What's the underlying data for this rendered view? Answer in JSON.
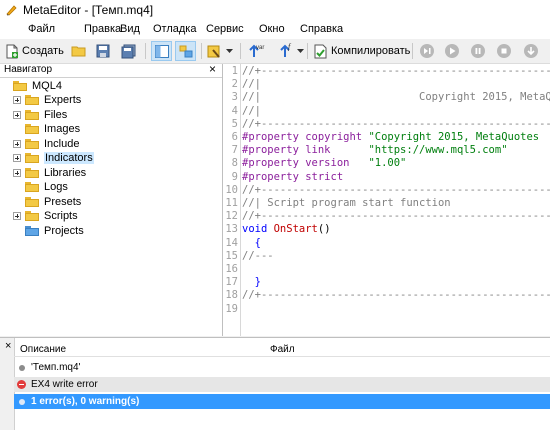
{
  "window": {
    "title": "MetaEditor - [Темп.mq4]"
  },
  "menu": [
    "Файл",
    "Правка",
    "Вид",
    "Отладка",
    "Сервис",
    "Окно",
    "Справка"
  ],
  "toolbar": {
    "create_label": "Создать",
    "compile_label": "Компилировать",
    "var_icon_text": "var",
    "f_icon_text": "f"
  },
  "navigator": {
    "title": "Навигатор",
    "close": "×",
    "root": "MQL4",
    "items": [
      {
        "label": "Experts",
        "expandable": true
      },
      {
        "label": "Files",
        "expandable": true
      },
      {
        "label": "Images",
        "expandable": false
      },
      {
        "label": "Include",
        "expandable": true
      },
      {
        "label": "Indicators",
        "expandable": true,
        "selected": true
      },
      {
        "label": "Libraries",
        "expandable": true
      },
      {
        "label": "Logs",
        "expandable": false
      },
      {
        "label": "Presets",
        "expandable": false
      },
      {
        "label": "Scripts",
        "expandable": true
      },
      {
        "label": "Projects",
        "expandable": false,
        "color": "blue"
      }
    ]
  },
  "editor": {
    "lines": [
      {
        "n": "1",
        "parts": [
          [
            "comment",
            "//+------------------------------------------------"
          ]
        ]
      },
      {
        "n": "2",
        "parts": [
          [
            "comment",
            "//|"
          ]
        ]
      },
      {
        "n": "3",
        "parts": [
          [
            "comment",
            "//|                         Copyright 2015, MetaQ"
          ]
        ]
      },
      {
        "n": "4",
        "parts": [
          [
            "comment",
            "//|"
          ]
        ]
      },
      {
        "n": "5",
        "parts": [
          [
            "comment",
            "//+------------------------------------------------"
          ]
        ]
      },
      {
        "n": "6",
        "parts": [
          [
            "directive",
            "#property copyright "
          ],
          [
            "str",
            "\"Copyright 2015, MetaQuotes"
          ]
        ]
      },
      {
        "n": "7",
        "parts": [
          [
            "directive",
            "#property link      "
          ],
          [
            "str",
            "\"https://www.mql5.com\""
          ]
        ]
      },
      {
        "n": "8",
        "parts": [
          [
            "directive",
            "#property version   "
          ],
          [
            "str",
            "\"1.00\""
          ]
        ]
      },
      {
        "n": "9",
        "parts": [
          [
            "directive",
            "#property strict"
          ]
        ]
      },
      {
        "n": "10",
        "parts": [
          [
            "comment",
            "//+------------------------------------------------"
          ]
        ]
      },
      {
        "n": "11",
        "parts": [
          [
            "comment",
            "//| Script program start function"
          ]
        ]
      },
      {
        "n": "12",
        "parts": [
          [
            "comment",
            "//+------------------------------------------------"
          ]
        ]
      },
      {
        "n": "13",
        "parts": [
          [
            "kw",
            "void "
          ],
          [
            "fn",
            "OnStart"
          ],
          [
            "plain",
            "()"
          ]
        ]
      },
      {
        "n": "14",
        "parts": [
          [
            "kw",
            "  {"
          ]
        ]
      },
      {
        "n": "15",
        "parts": [
          [
            "comment",
            "//---"
          ]
        ]
      },
      {
        "n": "16",
        "parts": [
          [
            "plain",
            ""
          ]
        ]
      },
      {
        "n": "17",
        "parts": [
          [
            "kw",
            "  }"
          ]
        ]
      },
      {
        "n": "18",
        "parts": [
          [
            "comment",
            "//+------------------------------------------------"
          ]
        ]
      },
      {
        "n": "19",
        "parts": [
          [
            "plain",
            ""
          ]
        ]
      }
    ]
  },
  "errors": {
    "close": "×",
    "col_description": "Описание",
    "col_file": "Файл",
    "rows": [
      {
        "icon": "dot",
        "text": "'Темп.mq4'",
        "bg": "#ffffff",
        "color": "#000000"
      },
      {
        "icon": "error",
        "text": "EX4 write error",
        "bg": "#e6e6e6",
        "color": "#000000"
      },
      {
        "icon": "dot",
        "text": "1 error(s), 0 warning(s)",
        "bg": "#3399ff",
        "color": "#ffffff",
        "bold": true
      }
    ]
  },
  "colors": {
    "accent": "#3399ff",
    "selection": "#cce8ff",
    "comment": "#808080",
    "directive": "#8b1f9c",
    "string": "#007f0e",
    "keyword": "#0000ff",
    "function": "#c00000"
  }
}
